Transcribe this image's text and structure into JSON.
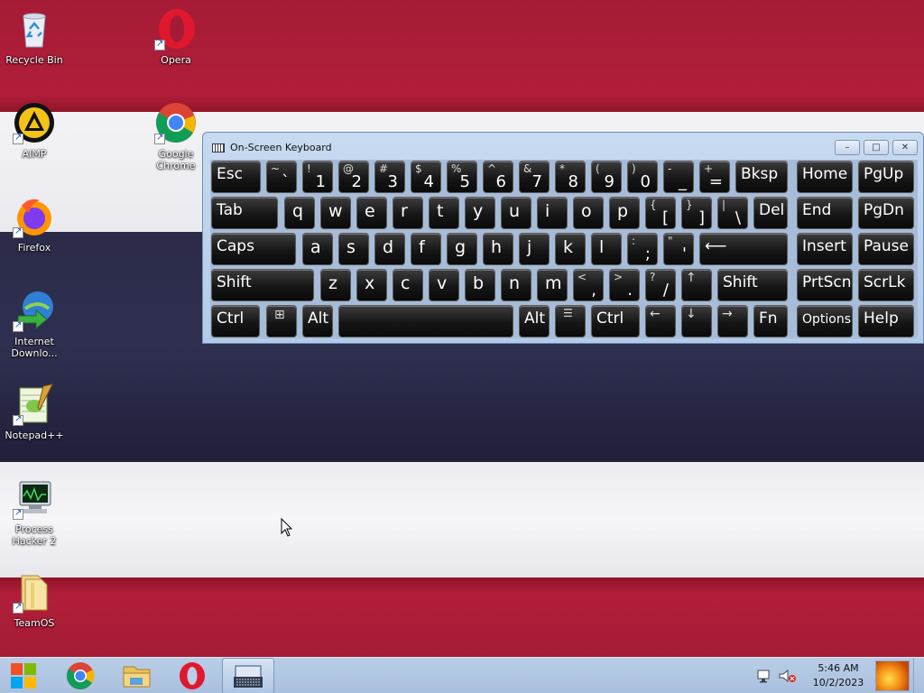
{
  "desktop": {
    "icons": [
      {
        "label": "Recycle Bin",
        "icon": "recycle-bin-icon"
      },
      {
        "label": "Opera",
        "icon": "opera-icon"
      },
      {
        "label": "AIMP",
        "icon": "aimp-icon"
      },
      {
        "label": "Google Chrome",
        "icon": "chrome-icon"
      },
      {
        "label": "Firefox",
        "icon": "firefox-icon"
      },
      {
        "label": "Internet Downlo...",
        "icon": "idm-icon"
      },
      {
        "label": "Notepad++",
        "icon": "notepadpp-icon"
      },
      {
        "label": "Process Hacker 2",
        "icon": "process-hacker-icon"
      },
      {
        "label": "TeamOS",
        "icon": "teamos-folder-icon"
      }
    ]
  },
  "osk": {
    "title": "On-Screen Keyboard",
    "buttons": {
      "minimize": "–",
      "maximize": "□",
      "close": "✕"
    },
    "keys": {
      "esc": "Esc",
      "bksp": "Bksp",
      "home": "Home",
      "pgup": "PgUp",
      "tab": "Tab",
      "del": "Del",
      "end": "End",
      "pgdn": "PgDn",
      "caps": "Caps",
      "insert": "Insert",
      "pause": "Pause",
      "shift": "Shift",
      "prtscn": "PrtScn",
      "scrlk": "ScrLk",
      "ctrl": "Ctrl",
      "alt": "Alt",
      "fn": "Fn",
      "options": "Options",
      "help": "Help",
      "enter": "⟵",
      "left": "←",
      "down": "↓",
      "right": "→",
      "up": "↑",
      "menu": "☰",
      "win": "⊞",
      "row1_letters": [
        "q",
        "w",
        "e",
        "r",
        "t",
        "y",
        "u",
        "i",
        "o",
        "p"
      ],
      "row2_letters": [
        "a",
        "s",
        "d",
        "f",
        "g",
        "h",
        "j",
        "k",
        "l"
      ],
      "row3_letters": [
        "z",
        "x",
        "c",
        "v",
        "b",
        "n",
        "m"
      ],
      "num_row": [
        {
          "shift": "~",
          "main": "`"
        },
        {
          "shift": "!",
          "main": "1"
        },
        {
          "shift": "@",
          "main": "2"
        },
        {
          "shift": "#",
          "main": "3"
        },
        {
          "shift": "$",
          "main": "4"
        },
        {
          "shift": "%",
          "main": "5"
        },
        {
          "shift": "^",
          "main": "6"
        },
        {
          "shift": "&",
          "main": "7"
        },
        {
          "shift": "*",
          "main": "8"
        },
        {
          "shift": "(",
          "main": "9"
        },
        {
          "shift": ")",
          "main": "0"
        },
        {
          "shift": "-",
          "main": "_"
        },
        {
          "shift": "+",
          "main": "="
        }
      ],
      "brackets": [
        {
          "shift": "{",
          "main": "["
        },
        {
          "shift": "}",
          "main": "]"
        },
        {
          "shift": "|",
          "main": "\\"
        }
      ],
      "semi_quote": [
        {
          "shift": ":",
          "main": ";"
        },
        {
          "shift": "\"",
          "main": "'"
        }
      ],
      "punct": [
        {
          "shift": "<",
          "main": ","
        },
        {
          "shift": ">",
          "main": "."
        },
        {
          "shift": "?",
          "main": "/"
        }
      ]
    }
  },
  "taskbar": {
    "items": [
      {
        "icon": "windows-start-icon"
      },
      {
        "icon": "chrome-icon"
      },
      {
        "icon": "file-explorer-icon"
      },
      {
        "icon": "opera-icon"
      },
      {
        "icon": "on-screen-keyboard-icon"
      }
    ],
    "time": "5:46 AM",
    "date": "10/2/2023"
  }
}
